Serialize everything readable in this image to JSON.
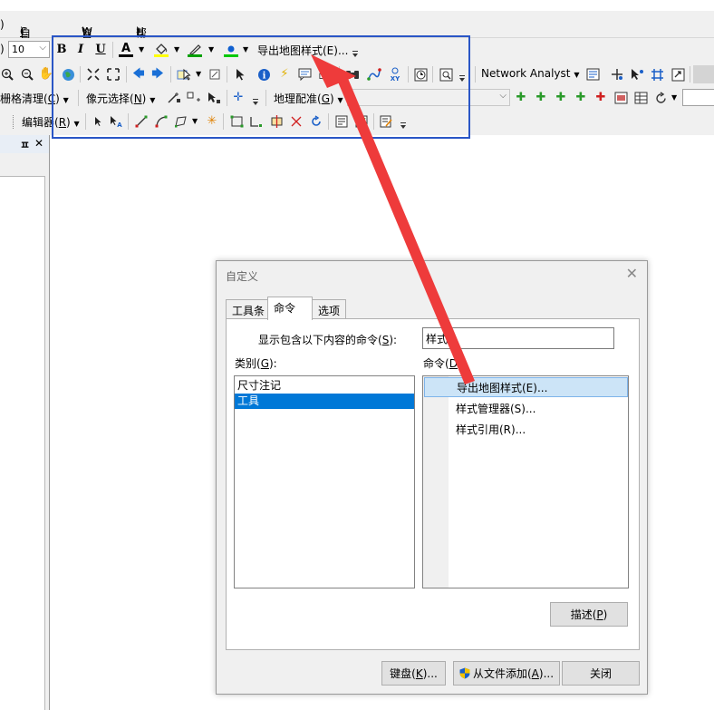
{
  "menubar": {
    "items": [
      {
        "text": ")"
      },
      {
        "label": "自定义(",
        "key": "C",
        "close": ")"
      },
      {
        "label": "窗口(",
        "key": "W",
        "close": ")"
      },
      {
        "label": "帮助(",
        "key": "H",
        "close": ")"
      }
    ]
  },
  "toolbar1": {
    "paren": ")",
    "font_size": "10",
    "bold": "B",
    "italic": "I",
    "underline": "U",
    "font_color_glyph": "A",
    "export_label": "导出地图样式(E)...",
    "font_color": "#000000",
    "fill_color": "#ffff00",
    "line_color": "#00a000",
    "marker_color": "#00c800"
  },
  "toolbar2": {
    "network_analyst": "Network Analyst",
    "icons": [
      "zoom-in-icon",
      "zoom-out-icon",
      "pan-icon",
      "globe-icon",
      "full-extent-icon",
      "back-icon",
      "forward-icon",
      "select-features-icon",
      "clear-selection-icon",
      "select-elements-icon",
      "identify-icon",
      "hyperlink-icon",
      "html-popup-icon",
      "measure-icon",
      "find-icon",
      "find-route-icon",
      "go-to-xy-icon",
      "time-slider-icon",
      "viewer-icon"
    ]
  },
  "toolbar3": {
    "raster_cleanup": "栅格清理(",
    "pixel_select": "像元选择(",
    "pixel_select_key": "N",
    "pixel_select_close": ")",
    "georef": "地理配准(",
    "georef_key": "G",
    "paren": ")"
  },
  "toolbar4": {
    "editor": "编辑器(",
    "editor_key": "R",
    "editor_close": ")"
  },
  "panel": {
    "pin": "ㅍ",
    "close": "✕"
  },
  "dialog": {
    "title": "自定义",
    "close": "✕",
    "tabs": [
      "工具条",
      "命令",
      "选项"
    ],
    "filter_label": "显示包含以下内容的命令(",
    "filter_key": "S",
    "filter_close": "):",
    "filter_value": "样式",
    "category_label": "类别(",
    "category_key": "G",
    "category_close": "):",
    "commands_label": "命令(",
    "commands_key": "D",
    "commands_close": "):",
    "categories": [
      {
        "label": "尺寸注记",
        "selected": false
      },
      {
        "label": "工具",
        "selected": true
      }
    ],
    "commands": [
      {
        "label": "导出地图样式(E)...",
        "selected": true
      },
      {
        "label": "样式管理器(S)...",
        "selected": false
      },
      {
        "label": "样式引用(R)...",
        "selected": false
      }
    ],
    "describe_label": "描述(",
    "describe_key": "P",
    "describe_close": ")",
    "keyboard_label": "键盘(",
    "keyboard_key": "K",
    "keyboard_close": ")...",
    "add_from_file_label": "从文件添加(",
    "add_from_file_key": "A",
    "add_from_file_close": ")...",
    "close_label": "关闭"
  },
  "annotation": {
    "highlight_color": "#2a56c6",
    "arrow_color": "#ee3b3b"
  }
}
